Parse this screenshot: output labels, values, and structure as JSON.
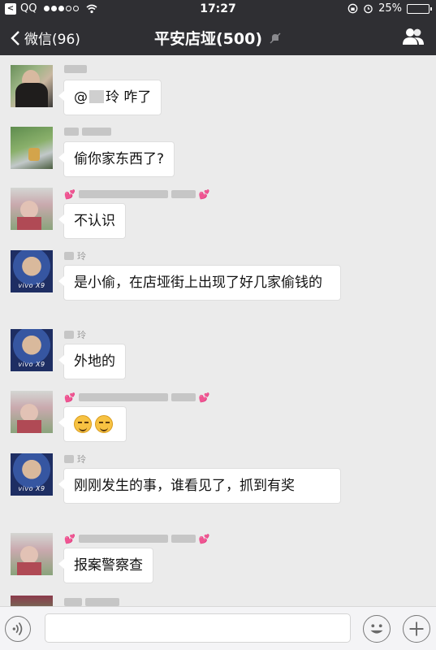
{
  "status_bar": {
    "carrier": "QQ",
    "signal_bars_filled": 3,
    "signal_bars_total": 5,
    "time": "17:27",
    "battery_percent": "25%",
    "battery_level": 0.25
  },
  "nav": {
    "back_label": "微信(96)",
    "title": "平安店垭(500)",
    "icons": [
      "chevron-left-icon",
      "mute-bell-icon",
      "group-members-icon"
    ]
  },
  "messages": [
    {
      "sender": "",
      "avatar": "avatar-woman",
      "text_before": "@",
      "text_after": "玲 咋了"
    },
    {
      "sender": "",
      "avatar": "avatar-outdoor",
      "text": "偷你家东西了?"
    },
    {
      "sender": "",
      "avatar": "avatar-child",
      "text": "不认识"
    },
    {
      "sender": "玲",
      "avatar": "avatar-vivo",
      "avatar_brand": "vivo X9",
      "text": "是小偷，在店垭街上出现了好几家偷钱的"
    },
    {
      "sender": "玲",
      "avatar": "avatar-vivo",
      "avatar_brand": "vivo X9",
      "text": "外地的"
    },
    {
      "sender": "",
      "avatar": "avatar-child",
      "emojis": [
        "grin-emoji",
        "grin-emoji"
      ]
    },
    {
      "sender": "玲",
      "avatar": "avatar-vivo",
      "avatar_brand": "vivo X9",
      "text": "刚刚发生的事，谁看见了，抓到有奖"
    },
    {
      "sender": "",
      "avatar": "avatar-child",
      "text": "报案警察查"
    }
  ],
  "input_bar": {
    "text_value": "",
    "icons": [
      "voice-icon",
      "emoji-icon",
      "plus-icon"
    ]
  },
  "colors": {
    "bar_background": "#2f2f33",
    "chat_background": "#ebebeb",
    "bubble": "#ffffff",
    "heart": "#e54da0"
  }
}
